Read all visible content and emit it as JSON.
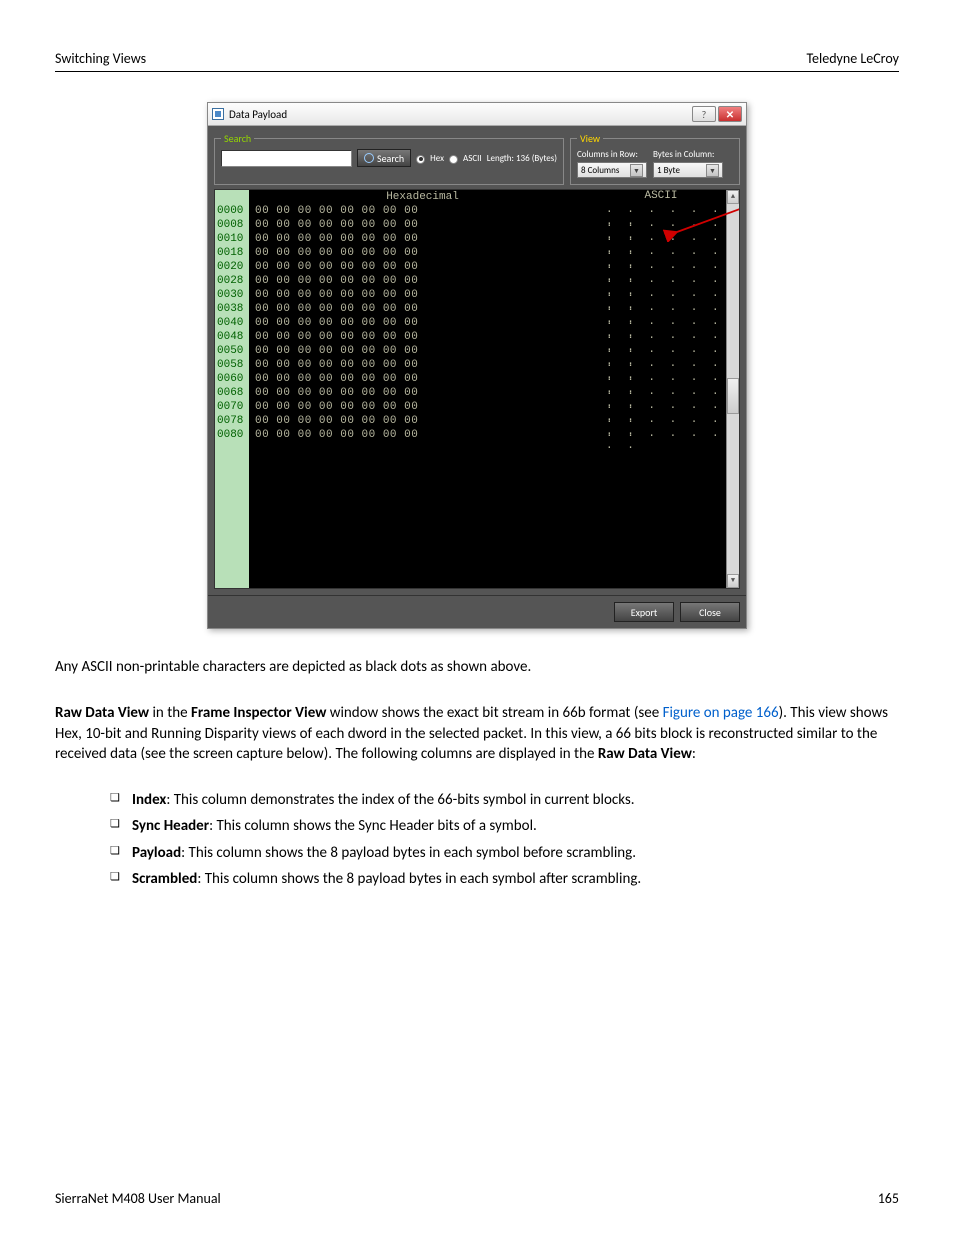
{
  "header": {
    "left": "Switching Views",
    "right": "Teledyne LeCroy"
  },
  "dialog": {
    "title": "Data Payload",
    "search": {
      "legend": "Search",
      "button": "Search",
      "hex": "Hex",
      "ascii": "ASCII",
      "length": "Length: 136 (Bytes)"
    },
    "view": {
      "legend": "View",
      "colsLabel": "Columns in Row:",
      "colsValue": "8 Columns",
      "bytesLabel": "Bytes in Column:",
      "bytesValue": "1 Byte"
    },
    "hexHeader": "Hexadecimal",
    "asciiHeader": "ASCII",
    "offsets": [
      "0000",
      "0008",
      "0010",
      "0018",
      "0020",
      "0028",
      "0030",
      "0038",
      "0040",
      "0048",
      "0050",
      "0058",
      "0060",
      "0068",
      "0070",
      "0078",
      "0080"
    ],
    "hexRow": "00 00 00 00 00 00 00 00",
    "asciiRow": ". . . . . . . .",
    "export": "Export",
    "close": "Close"
  },
  "body": {
    "p1": "Any ASCII non-printable characters are depicted as black dots as shown above.",
    "p2a": "Raw Data View",
    "p2b": " in the ",
    "p2c": "Frame Inspector View",
    "p2d": " window shows the exact bit stream in 66b format (see ",
    "p2link": "Figure  on page 166",
    "p2e": "). This view shows Hex, 10-bit and Running Disparity views of each dword in the selected packet. In this view, a 66 bits block is reconstructed similar to the received data (see the screen capture below). The following columns are displayed in the ",
    "p2f": "Raw Data View",
    "p2g": ":",
    "li1a": "Index",
    "li1b": ": This column demonstrates the index of the 66-bits symbol in current blocks.",
    "li2a": "Sync Header",
    "li2b": ": This column shows the Sync Header bits of a symbol.",
    "li3a": "Payload",
    "li3b": ": This column shows the 8 payload bytes in each symbol before scrambling.",
    "li4a": "Scrambled",
    "li4b": ": This column shows the 8 payload bytes in each symbol after scrambling."
  },
  "footer": {
    "left": "SierraNet M408 User Manual",
    "right": "165"
  }
}
